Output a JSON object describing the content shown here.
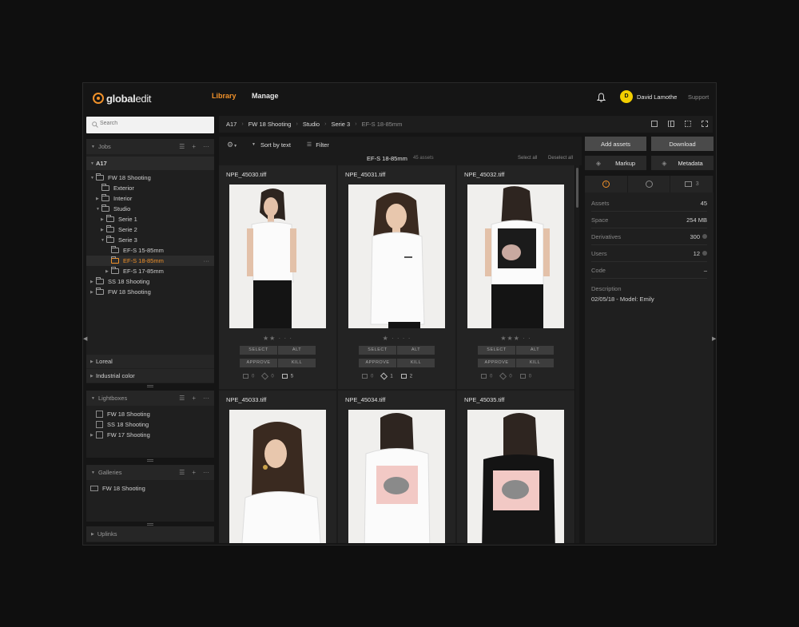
{
  "app": {
    "logo_prefix": "global",
    "logo_suffix": "edit"
  },
  "nav": {
    "library": "Library",
    "manage": "Manage"
  },
  "user": {
    "initial": "D",
    "name": "David Lamothe",
    "support": "Support"
  },
  "search": {
    "placeholder": "Search"
  },
  "jobs": {
    "title": "Jobs",
    "tree": [
      {
        "label": "A17"
      },
      {
        "label": "FW 18 Shooting"
      },
      {
        "label": "Exterior"
      },
      {
        "label": "Interior"
      },
      {
        "label": "Studio"
      },
      {
        "label": "Serie 1"
      },
      {
        "label": "Serie 2"
      },
      {
        "label": "Serie 3"
      },
      {
        "label": "EF-S 15-85mm"
      },
      {
        "label": "EF-S 18-85mm"
      },
      {
        "label": "EF-S 17-85mm"
      },
      {
        "label": "SS 18 Shooting"
      },
      {
        "label": "FW 18 Shooting"
      }
    ],
    "clients": [
      "Loreal",
      "Industrial color"
    ]
  },
  "lightboxes": {
    "title": "Lightboxes",
    "items": [
      "FW 18 Shooting",
      "SS 18 Shooting",
      "FW 17 Shooting"
    ]
  },
  "galleries": {
    "title": "Galleries",
    "items": [
      "FW 18 Shooting"
    ]
  },
  "uplinks": {
    "title": "Uplinks"
  },
  "breadcrumb": [
    "A17",
    "FW 18 Shooting",
    "Studio",
    "Serie 3",
    "EF-S 18-85mm"
  ],
  "toolbar": {
    "sort": "Sort by text",
    "filter": "Filter"
  },
  "grid": {
    "folder": "EF-S 18-85mm",
    "count": "45 assets",
    "select_all": "Select all",
    "deselect_all": "Deselect all",
    "buttons": {
      "select": "SELECT",
      "alt": "ALT",
      "approve": "APPROVE",
      "kill": "KILL"
    },
    "assets": [
      {
        "name": "NPE_45030.tiff",
        "rating": 2,
        "stars": "★★ · · ·",
        "versions": "0",
        "layers": "0",
        "comments": "5"
      },
      {
        "name": "NPE_45031.tiff",
        "rating": 1,
        "stars": "★ · · · ·",
        "versions": "0",
        "layers": "1",
        "comments": "2"
      },
      {
        "name": "NPE_45032.tiff",
        "rating": 3,
        "stars": "★★★ · ·",
        "versions": "0",
        "layers": "0",
        "comments": "0"
      },
      {
        "name": "NPE_45033.tiff"
      },
      {
        "name": "NPE_45034.tiff"
      },
      {
        "name": "NPE_45035.tiff"
      }
    ]
  },
  "actions": {
    "add_assets": "Add assets",
    "download": "Download",
    "markup": "Markup",
    "metadata": "Metadata"
  },
  "info": {
    "comments_tab": "3",
    "rows": [
      {
        "label": "Assets",
        "value": "45"
      },
      {
        "label": "Space",
        "value": "254 MB"
      },
      {
        "label": "Derivatives",
        "value": "300"
      },
      {
        "label": "Users",
        "value": "12"
      },
      {
        "label": "Code",
        "value": "–"
      }
    ],
    "description_label": "Description",
    "description": "02/05/18 - Model: Emily"
  },
  "colors": {
    "accent": "#f0912a",
    "avatar": "#f3cf00",
    "background": "#151515"
  }
}
